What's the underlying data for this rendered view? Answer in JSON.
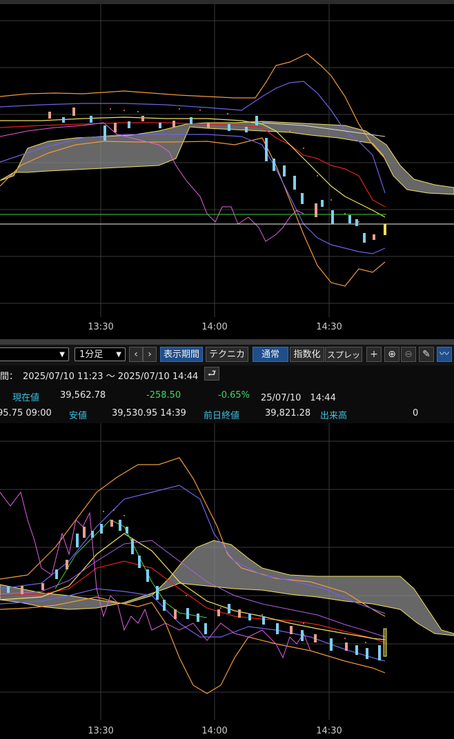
{
  "colors": {
    "candle_up": "#e8a08a",
    "candle_down": "#7ecff0",
    "cloud": "#8a8a8a",
    "orange": "#f29a3a",
    "purple": "#6e62e8",
    "magenta": "#e060e0",
    "red": "#e02020",
    "yellow": "#f0e060",
    "green": "#40d040",
    "white": "#f0f0f0"
  },
  "chart_top": {
    "x_labels": [
      "13:30",
      "14:00",
      "14:30"
    ]
  },
  "chart_bottom": {
    "x_labels": [
      "13:30",
      "14:00",
      "14:30"
    ]
  },
  "toolbar": {
    "symbol_select": "",
    "interval_select": "1分足",
    "prev_icon": "chevron-left-icon",
    "next_icon": "chevron-right-icon",
    "period_button": "表示期間",
    "technical_button": "テクニカル",
    "normal_button": "通常",
    "index_button": "指数化",
    "spread_button": "スプレッド"
  },
  "info": {
    "period_label": "間：",
    "period_value": "2025/07/10 11:23 ～ 2025/07/10 14:44",
    "current_label": "現在値",
    "current_value": "39,562.78",
    "change_value": "-258.50",
    "change_pct": "-0.65%",
    "current_time": "25/07/10　14:44",
    "high_partial": "95.75  09:00",
    "low_label": "安値",
    "low_value": "39,530.95  14:39",
    "prev_close_label": "前日終値",
    "prev_close_value": "39,821.28",
    "volume_label": "出来高",
    "volume_value": "0"
  }
}
